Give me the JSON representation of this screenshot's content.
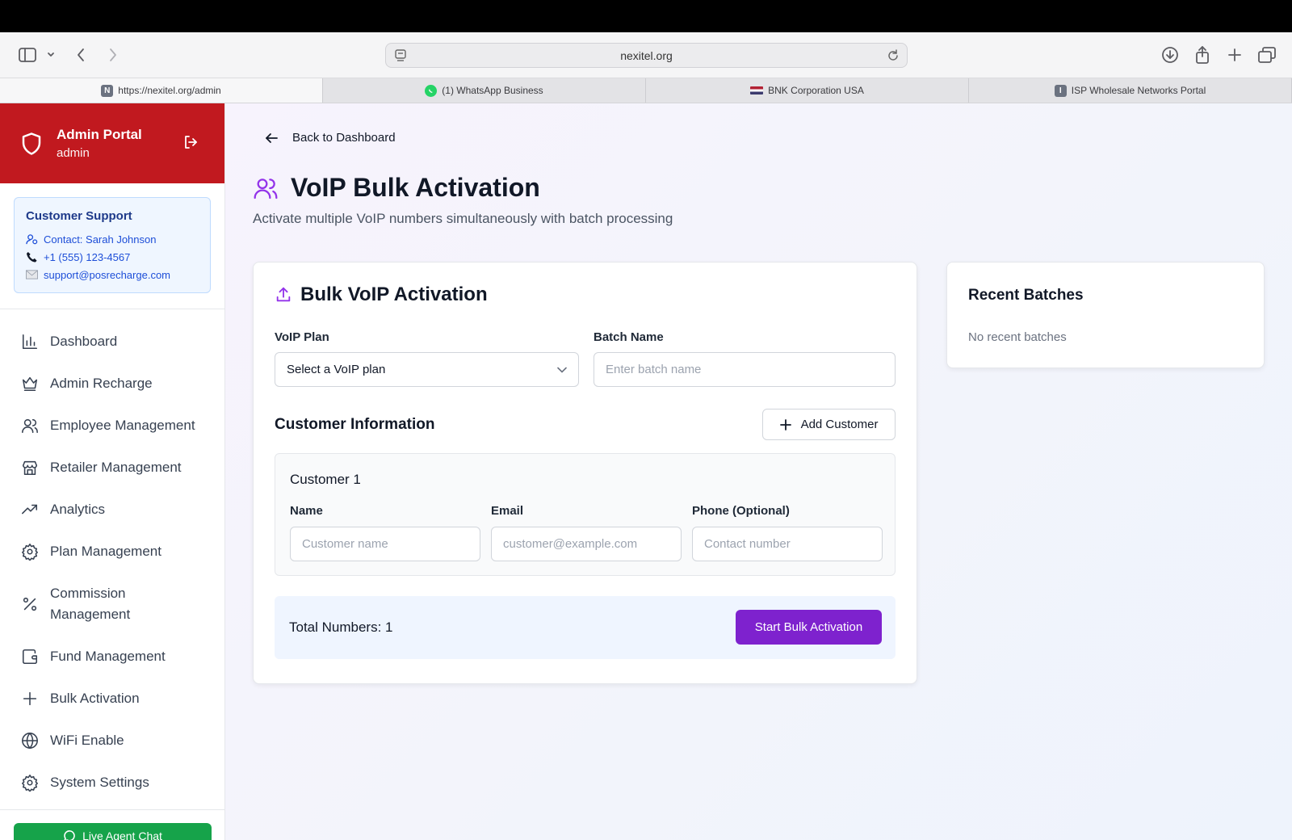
{
  "browser": {
    "url": "nexitel.org",
    "tabs": [
      {
        "label": "https://nexitel.org/admin",
        "icon": "N"
      },
      {
        "label": "(1) WhatsApp Business",
        "icon": "whatsapp-icon"
      },
      {
        "label": "BNK Corporation USA",
        "icon": "flag-icon"
      },
      {
        "label": "ISP Wholesale Networks Portal",
        "icon": "I"
      }
    ]
  },
  "sidebar": {
    "title": "Admin Portal",
    "role": "admin",
    "support": {
      "title": "Customer Support",
      "contact": "Contact: Sarah Johnson",
      "phone": "+1 (555) 123-4567",
      "email": "support@posrecharge.com"
    },
    "items": [
      {
        "label": "Dashboard",
        "icon": "bar-chart-icon"
      },
      {
        "label": "Admin Recharge",
        "icon": "crown-icon"
      },
      {
        "label": "Employee Management",
        "icon": "users-icon"
      },
      {
        "label": "Retailer Management",
        "icon": "store-icon"
      },
      {
        "label": "Analytics",
        "icon": "trending-up-icon"
      },
      {
        "label": "Plan Management",
        "icon": "gear-icon"
      },
      {
        "label": "Commission Management",
        "icon": "percent-icon"
      },
      {
        "label": "Fund Management",
        "icon": "wallet-icon"
      },
      {
        "label": "Bulk Activation",
        "icon": "plus-icon"
      },
      {
        "label": "WiFi Enable",
        "icon": "globe-icon"
      },
      {
        "label": "System Settings",
        "icon": "gear-icon"
      }
    ],
    "live_chat": "Live Agent Chat"
  },
  "main": {
    "back": "Back to Dashboard",
    "title": "VoIP Bulk Activation",
    "subtitle": "Activate multiple VoIP numbers simultaneously with batch processing",
    "form": {
      "heading": "Bulk VoIP Activation",
      "plan_label": "VoIP Plan",
      "plan_value": "Select a VoIP plan",
      "batch_label": "Batch Name",
      "batch_placeholder": "Enter batch name",
      "customer_section": "Customer Information",
      "add_customer": "Add Customer",
      "customer": {
        "title": "Customer 1",
        "name_label": "Name",
        "name_placeholder": "Customer name",
        "email_label": "Email",
        "email_placeholder": "customer@example.com",
        "phone_label": "Phone (Optional)",
        "phone_placeholder": "Contact number"
      },
      "total": "Total Numbers: 1",
      "start": "Start Bulk Activation"
    },
    "recent": {
      "title": "Recent Batches",
      "empty": "No recent batches"
    }
  },
  "colors": {
    "brand_red": "#c1191f",
    "accent_purple": "#7e22ce",
    "support_blue": "#1d4ed8",
    "chat_green": "#16a34a"
  }
}
